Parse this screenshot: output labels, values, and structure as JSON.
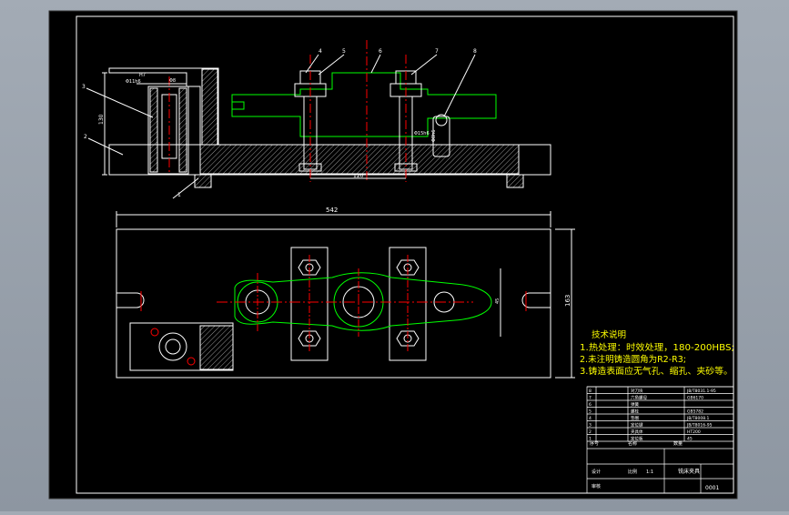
{
  "colors": {
    "background": "#000000",
    "outline": "#ffffff",
    "part": "#00ff00",
    "center_line": "#ff0000",
    "leader": "#00ffff",
    "text": "#ffff00"
  },
  "dimensions": {
    "height_130": "130",
    "width_542": "542",
    "height_163": "163",
    "spacing_120": "120",
    "h7_note": "H7",
    "fit_note": "Φ11h6",
    "thread_note": "Φ8",
    "bolt_note": "Φ15h6",
    "pin_note": "Φ8h6",
    "right_dim": "45"
  },
  "balloons": [
    "1",
    "2",
    "3",
    "4",
    "5",
    "6",
    "7",
    "8"
  ],
  "technical_notes": {
    "title": "技术说明",
    "lines": [
      "1.热处理：时效处理，180-200HBS;",
      "2.未注明铸造圆角为R2-R3;",
      "3.铸造表面应无气孔、缩孔、夹砂等。"
    ]
  },
  "title_block": {
    "bom_rows": [
      {
        "no": "8",
        "name": "对刀块",
        "spec": "JB/T8031.1-95"
      },
      {
        "no": "7",
        "name": "六角螺母",
        "spec": "GB6170"
      },
      {
        "no": "6",
        "name": "弹簧",
        "spec": ""
      },
      {
        "no": "5",
        "name": "螺栓",
        "spec": "GB5782"
      },
      {
        "no": "4",
        "name": "垫圈",
        "spec": "JB/T8008.1"
      },
      {
        "no": "3",
        "name": "定位键",
        "spec": "JB/T8016-95"
      },
      {
        "no": "2",
        "name": "夹具体",
        "spec": "HT200"
      },
      {
        "no": "1",
        "name": "定位板",
        "spec": "45"
      }
    ],
    "header": {
      "no": "序号",
      "name": "名称",
      "qty": "数量"
    },
    "drawing_title": "铣床夹具",
    "scale_label": "比例",
    "scale_value": "1:1",
    "designer_label": "设计",
    "checker_label": "审核",
    "sheet_no": "0001"
  }
}
